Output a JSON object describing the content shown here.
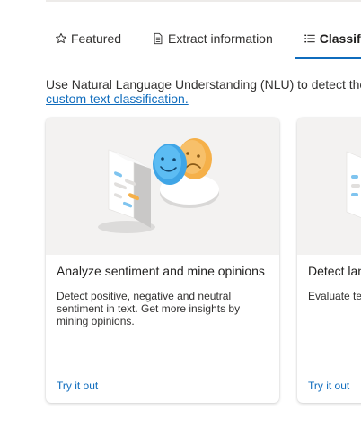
{
  "tabs": [
    {
      "label": "Featured",
      "icon": "star-icon",
      "active": false
    },
    {
      "label": "Extract information",
      "icon": "document-icon",
      "active": false
    },
    {
      "label": "Classify",
      "icon": "list-icon",
      "active": true
    }
  ],
  "description": {
    "text": "Use Natural Language Understanding (NLU) to detect the",
    "link": "custom text classification."
  },
  "cards": [
    {
      "title": "Analyze sentiment and mine opinions",
      "description": "Detect positive, negative and neutral sentiment in text. Get more insights by mining opinions.",
      "cta": "Try it out",
      "image": "sentiment-illustration"
    },
    {
      "title": "Detect lan",
      "description": "Evaluate te languages",
      "cta": "Try it out",
      "image": "language-illustration"
    }
  ],
  "colors": {
    "accent": "#0f6cbd",
    "card_image_bg": "#f3f2f1",
    "happy_face": "#4fb6ef",
    "sad_face": "#f5b049"
  }
}
